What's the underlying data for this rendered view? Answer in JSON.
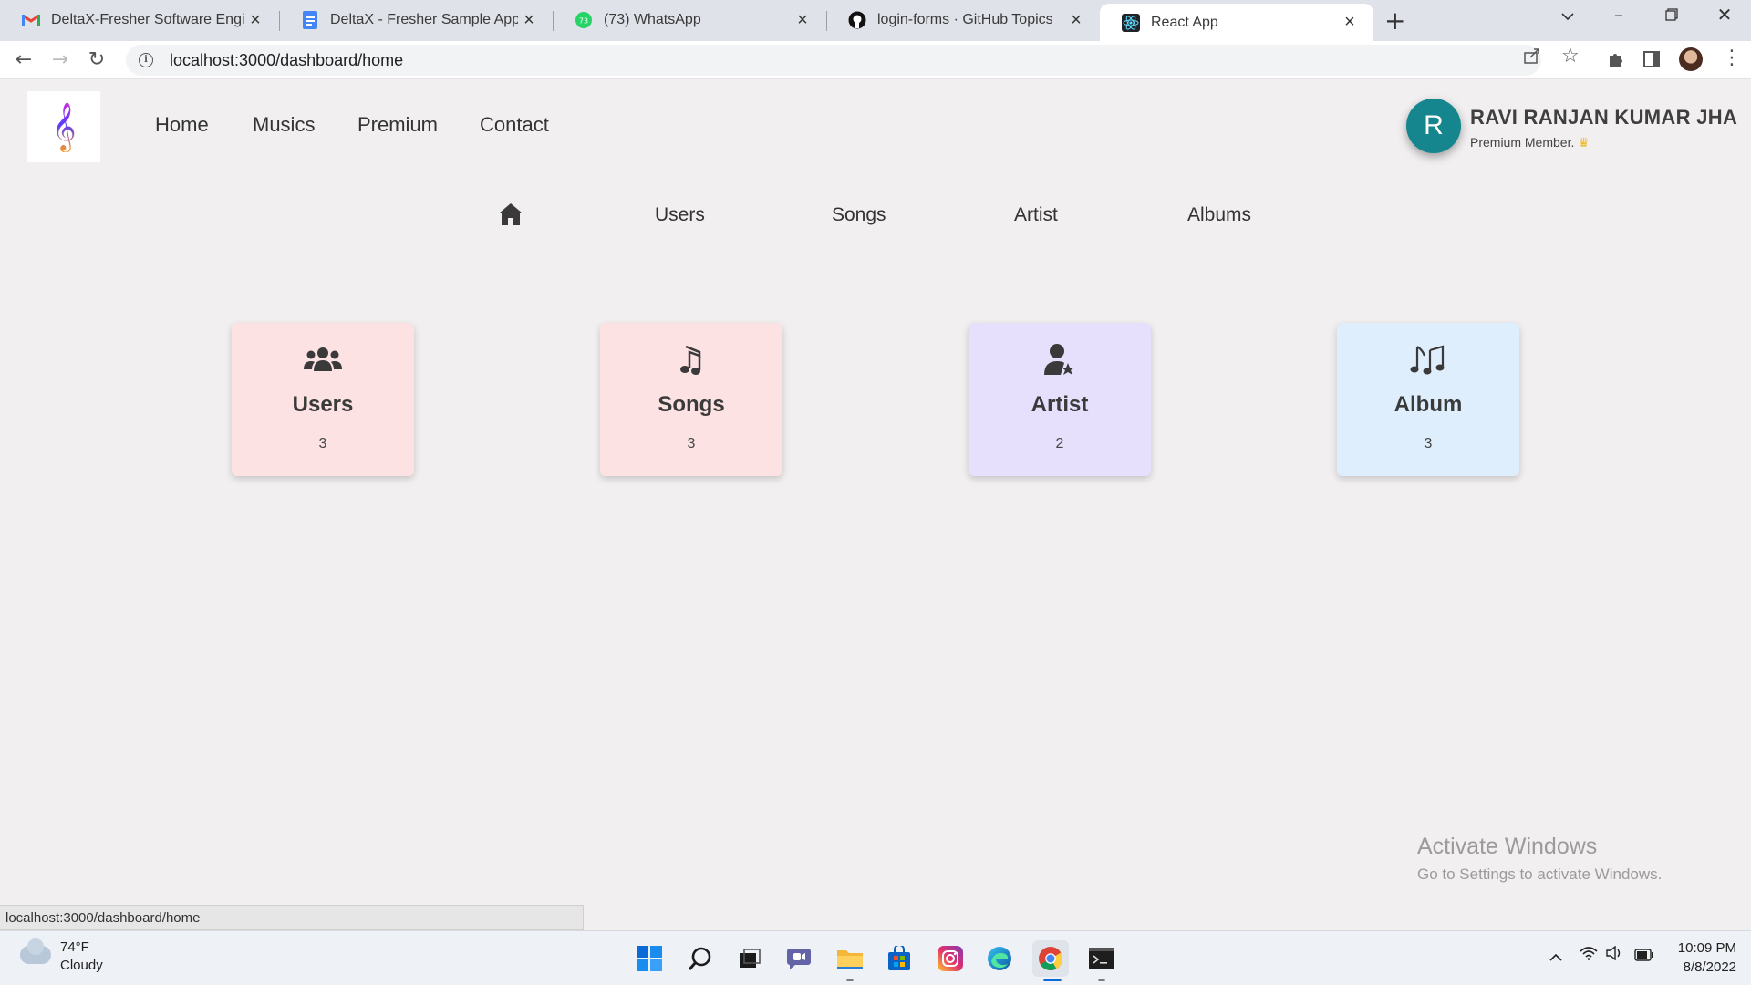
{
  "browser": {
    "tabs": [
      {
        "title": "DeltaX-Fresher Software Enginee",
        "icon": "gmail-icon"
      },
      {
        "title": "DeltaX - Fresher Sample App - Sp",
        "icon": "docs-icon"
      },
      {
        "title": "(73) WhatsApp",
        "icon": "whatsapp-icon"
      },
      {
        "title": "login-forms · GitHub Topics",
        "icon": "github-icon"
      },
      {
        "title": "React App",
        "icon": "react-icon"
      }
    ],
    "whatsapp_badge": "73",
    "url": "localhost:3000/dashboard/home"
  },
  "app": {
    "nav": [
      "Home",
      "Musics",
      "Premium",
      "Contact"
    ],
    "user": {
      "initial": "R",
      "name": "RAVI RANJAN KUMAR JHA",
      "membership": "Premium Member."
    },
    "subnav": [
      "Users",
      "Songs",
      "Artist",
      "Albums"
    ],
    "cards": [
      {
        "label": "Users",
        "count": "3",
        "icon": "users-icon",
        "color": "#fde2e4"
      },
      {
        "label": "Songs",
        "count": "3",
        "icon": "music-note-icon",
        "color": "#fde2e4"
      },
      {
        "label": "Artist",
        "count": "2",
        "icon": "user-star-icon",
        "color": "#e6e0fc"
      },
      {
        "label": "Album",
        "count": "3",
        "icon": "music-notes-icon",
        "color": "#deeefc"
      }
    ],
    "accent": "#15868e"
  },
  "overlay": {
    "activate_title": "Activate Windows",
    "activate_sub": "Go to Settings to activate Windows.",
    "status_url": "localhost:3000/dashboard/home"
  },
  "taskbar": {
    "temperature": "74°F",
    "condition": "Cloudy",
    "time": "10:09 PM",
    "date": "8/8/2022"
  }
}
